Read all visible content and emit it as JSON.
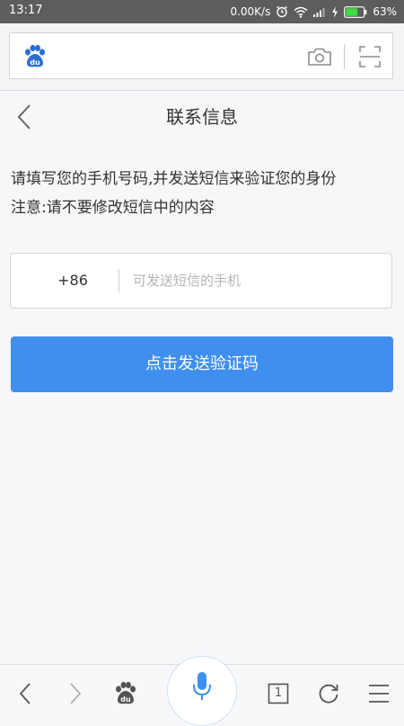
{
  "status_bar": {
    "time": "13:17",
    "net_speed": "0.00K/s",
    "battery": "63%",
    "icons": [
      "alarm-icon",
      "wifi-icon",
      "signal-icon",
      "charging-icon",
      "battery-icon"
    ]
  },
  "browser": {
    "logo_text": "du",
    "icons": [
      "baidu-logo-icon",
      "camera-icon",
      "scan-icon"
    ]
  },
  "page": {
    "title": "联系信息",
    "instruction_line1": "请填写您的手机号码,并发送短信来验证您的身份",
    "instruction_line2": "注意:请不要修改短信中的内容",
    "country_code": "+86",
    "phone_placeholder": "可发送短信的手机",
    "phone_value": "",
    "send_button": "点击发送验证码"
  },
  "toolbar": {
    "tab_count": "1",
    "icons": [
      "back-icon",
      "forward-icon",
      "baidu-home-icon",
      "microphone-icon",
      "tabs-icon",
      "refresh-icon",
      "menu-icon"
    ]
  },
  "colors": {
    "accent": "#3f8fee",
    "status_bar": "#5d5d5d",
    "battery_fill": "#3ddc3d"
  }
}
